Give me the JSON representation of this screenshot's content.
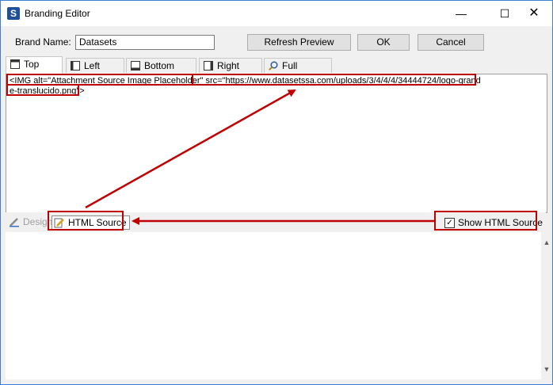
{
  "window": {
    "title": "Branding Editor",
    "app_icon": "S"
  },
  "brand": {
    "label": "Brand Name:",
    "value": "Datasets"
  },
  "buttons": {
    "refresh": "Refresh Preview",
    "ok": "OK",
    "cancel": "Cancel"
  },
  "tabs": [
    {
      "label": "Top Pane",
      "icon": "top-pane-icon"
    },
    {
      "label": "Left Pane",
      "icon": "left-pane-icon"
    },
    {
      "label": "Bottom Pane",
      "icon": "bottom-pane-icon"
    },
    {
      "label": "Right Pane",
      "icon": "right-pane-icon"
    },
    {
      "label": "Full Preview",
      "icon": "magnifier-icon"
    }
  ],
  "editor": {
    "code": "<IMG alt=\"Attachment Source Image Placeholder\" src=\"https://www.datasetssa.com/uploads/3/4/4/4/34444724/logo-grande-translucido.png\">"
  },
  "modes": {
    "design": "Design",
    "html_source": "HTML Source",
    "show_html_source": "Show HTML Source",
    "show_html_checked": true
  },
  "colors": {
    "annotation": "#c00000",
    "accent": "#1f4f9c"
  }
}
